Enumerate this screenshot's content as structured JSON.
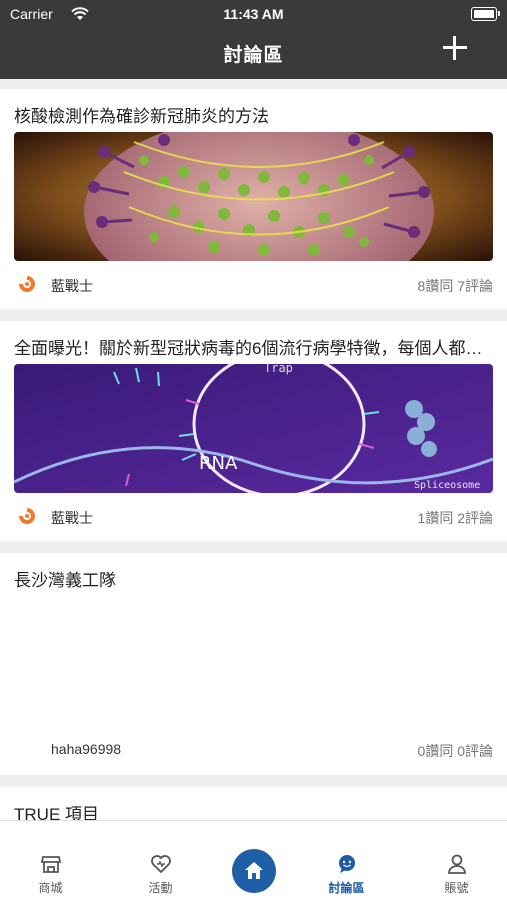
{
  "status_bar": {
    "carrier": "Carrier",
    "time": "11:43 AM"
  },
  "header": {
    "title": "討論區"
  },
  "posts": [
    {
      "title": "核酸檢測作為確診新冠肺炎的方法",
      "author": "藍戰士",
      "stats": "8讚同 7評論",
      "has_image": true
    },
    {
      "title": "全面曝光！關於新型冠狀病毒的6個流行病學特徵，每個人都…",
      "author": "藍戰士",
      "stats": "1讚同 2評論",
      "has_image": true,
      "image_text": [
        "Trap",
        "RNA",
        "Spliceosome"
      ]
    },
    {
      "title": "長沙灣義工隊",
      "author": "haha96998",
      "stats": "0讚同 0評論",
      "has_image": false
    },
    {
      "title": "TRUE 項目",
      "has_image": true
    }
  ],
  "tabbar": {
    "items": [
      {
        "label": "商城",
        "icon": "store-icon"
      },
      {
        "label": "活動",
        "icon": "heart-icon"
      },
      {
        "label": "",
        "icon": "home-icon"
      },
      {
        "label": "討論區",
        "icon": "chat-icon",
        "active": true
      },
      {
        "label": "賬號",
        "icon": "user-icon"
      }
    ]
  },
  "colors": {
    "header_bg": "#3a3a3a",
    "accent": "#1f5fa7",
    "brand_orange": "#f07a2c"
  }
}
